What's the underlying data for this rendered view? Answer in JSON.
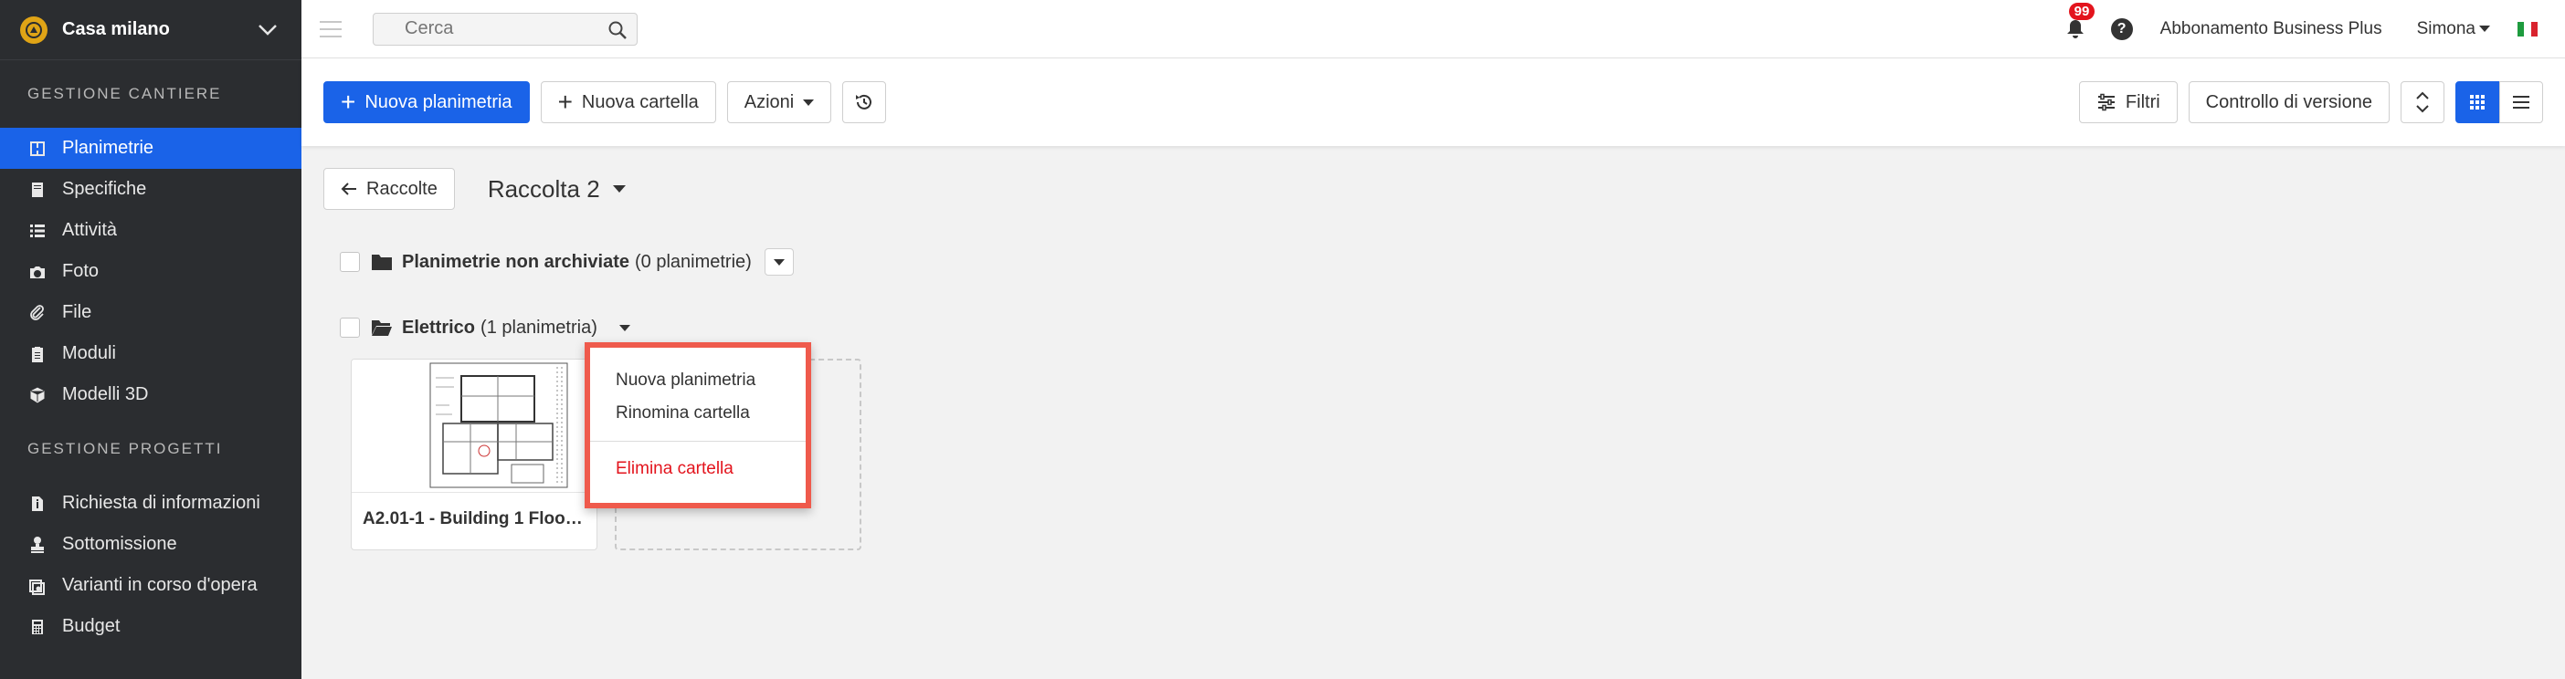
{
  "project": {
    "name": "Casa milano"
  },
  "sidebar": {
    "sections": [
      {
        "title": "GESTIONE CANTIERE",
        "items": [
          {
            "label": "Planimetrie",
            "icon": "floorplan-icon",
            "active": true
          },
          {
            "label": "Specifiche",
            "icon": "book-icon"
          },
          {
            "label": "Attività",
            "icon": "list-icon"
          },
          {
            "label": "Foto",
            "icon": "camera-icon"
          },
          {
            "label": "File",
            "icon": "paperclip-icon"
          },
          {
            "label": "Moduli",
            "icon": "clipboard-icon"
          },
          {
            "label": "Modelli 3D",
            "icon": "cube-icon"
          }
        ]
      },
      {
        "title": "GESTIONE PROGETTI",
        "items": [
          {
            "label": "Richiesta di informazioni",
            "icon": "file-info-icon"
          },
          {
            "label": "Sottomissione",
            "icon": "stamp-icon"
          },
          {
            "label": "Varianti in corso d'opera",
            "icon": "change-order-icon"
          },
          {
            "label": "Budget",
            "icon": "calculator-icon"
          }
        ]
      }
    ]
  },
  "topbar": {
    "search_placeholder": "Cerca",
    "notifications": "99",
    "help": "?",
    "subscription": "Abbonamento Business Plus",
    "user": "Simona"
  },
  "toolbar": {
    "new_plan": "Nuova planimetria",
    "new_folder": "Nuova cartella",
    "actions": "Azioni",
    "filters": "Filtri",
    "version_control": "Controllo di versione"
  },
  "content": {
    "back": "Raccolte",
    "collection": "Raccolta 2",
    "folders": [
      {
        "name": "Planimetrie non archiviate",
        "count": "(0 planimetrie)"
      },
      {
        "name": "Elettrico",
        "count": "(1 planimetria)"
      }
    ],
    "card_title": "A2.01-1 - Building 1 Floor ...",
    "dropdown": {
      "new_plan": "Nuova planimetria",
      "rename": "Rinomina cartella",
      "delete": "Elimina cartella"
    }
  },
  "colors": {
    "accent": "#1a63e8",
    "sidebar": "#2b2d30",
    "danger": "#e3141d",
    "highlight": "#ef5a4c"
  }
}
